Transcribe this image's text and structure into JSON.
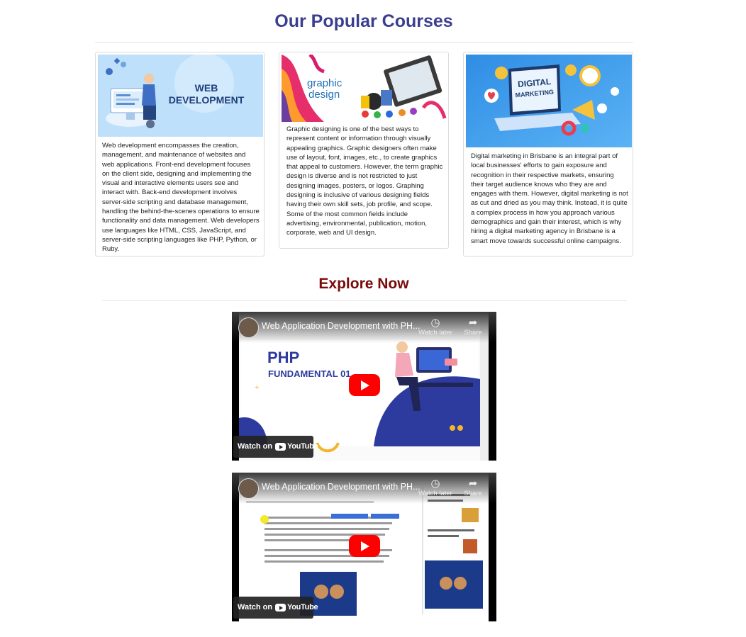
{
  "courses_section": {
    "title": "Our Popular Courses",
    "cards": [
      {
        "image_heading": [
          "WEB",
          "DEVELOPMENT"
        ],
        "description": "Web development encompasses the creation, management, and maintenance of websites and web applications. Front-end development focuses on the client side, designing and implementing the visual and interactive elements users see and interact with. Back-end development involves server-side scripting and database management, handling the behind-the-scenes operations to ensure functionality and data management. Web developers use languages like HTML, CSS, JavaScript, and server-side scripting languages like PHP, Python, or Ruby."
      },
      {
        "image_heading": [
          "graphic",
          "design"
        ],
        "description": "Graphic designing is one of the best ways to represent content or information through visually appealing graphics. Graphic designers often make use of layout, font, images, etc., to create graphics that appeal to customers. However, the term graphic design is diverse and is not restricted to just designing images, posters, or logos. Graphing designing is inclusive of various designing fields having their own skill sets, job profile, and scope. Some of the most common fields include advertising, environmental, publication, motion, corporate, web and UI design."
      },
      {
        "image_heading": [
          "DIGITAL",
          "MARKETING"
        ],
        "description": "Digital marketing in Brisbane is an integral part of local businesses' efforts to gain exposure and recognition in their respective markets, ensuring their target audience knows who they are and engages with them. However, digital marketing is not as cut and dried as you may think. Instead, it is quite a complex process in how you approach various demographics and gain their interest, which is why hiring a digital marketing agency in Brisbane is a smart move towards successful online campaigns."
      }
    ]
  },
  "explore_section": {
    "title": "Explore Now",
    "videos": [
      {
        "title": "Web Application Development with PH...",
        "watch_later": "Watch later",
        "share": "Share",
        "watch_on": "Watch on",
        "youtube": "YouTube",
        "slide_title": "PHP",
        "slide_subtitle": "FUNDAMENTAL 01"
      },
      {
        "title": "Web Application Development with PH...",
        "watch_later": "Watch later",
        "share": "Share",
        "watch_on": "Watch on",
        "youtube": "YouTube"
      }
    ]
  },
  "colors": {
    "courses_title": "#3b3f8f",
    "explore_title": "#7a0a0a",
    "play_button": "#ff0000"
  }
}
